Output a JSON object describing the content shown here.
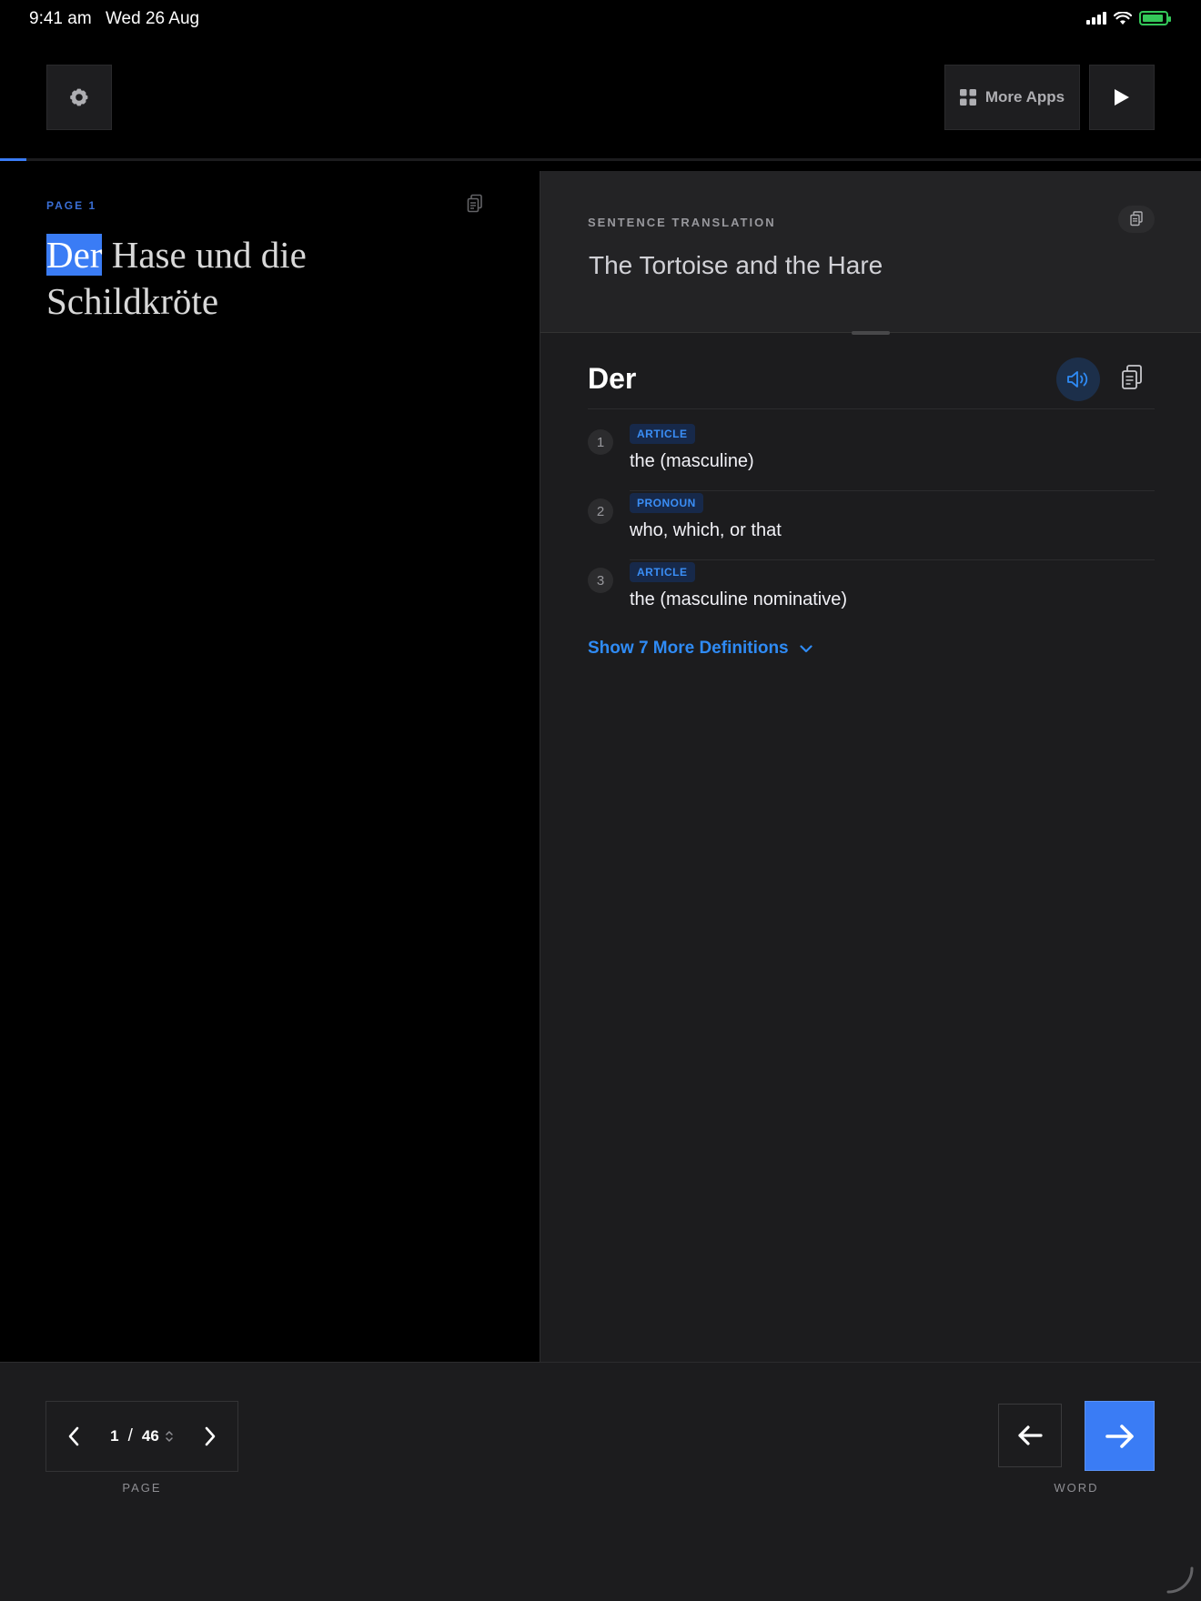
{
  "status_bar": {
    "time": "9:41 am",
    "date": "Wed 26 Aug"
  },
  "toolbar": {
    "settings_icon": "gear-icon",
    "more_apps_label": "More Apps",
    "more_apps_icon": "grid-icon",
    "play_icon": "play-icon"
  },
  "reading_progress": 0.022,
  "left": {
    "page_label": "PAGE 1",
    "sentence_words": [
      "Der",
      "Hase",
      "und",
      "die",
      "Schildkröte"
    ],
    "highlighted_word_index": 0
  },
  "translation": {
    "label": "SENTENCE TRANSLATION",
    "text": "The Tortoise and the Hare"
  },
  "word": {
    "headword": "Der",
    "definitions": [
      {
        "num": "1",
        "pos": "ARTICLE",
        "text": "the (masculine)"
      },
      {
        "num": "2",
        "pos": "PRONOUN",
        "text": "who, which, or that"
      },
      {
        "num": "3",
        "pos": "ARTICLE",
        "text": "the (masculine nominative)"
      }
    ],
    "show_more": "Show 7 More Definitions"
  },
  "bottom": {
    "current_page": "1",
    "page_separator": "/",
    "total_pages": "46",
    "page_label": "PAGE",
    "word_label": "WORD"
  },
  "colors": {
    "accent": "#3a7cf5",
    "link": "#2f8bf5",
    "panel": "#1c1c1e",
    "highlight": "#3a7cf5"
  }
}
